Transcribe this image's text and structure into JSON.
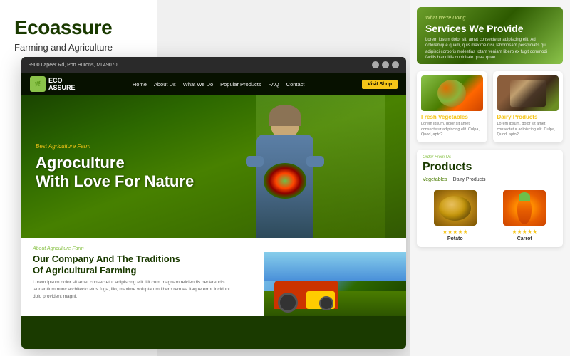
{
  "brand": {
    "title": "Ecoassure",
    "subtitle": "Farming and Agriculture"
  },
  "topbar": {
    "address": "9900 Lapeer Rd, Port Hurons, MI 49070"
  },
  "navbar": {
    "logo_text": "ECO\nASSURE",
    "links": [
      "Home",
      "About Us",
      "What We Do",
      "Popular Products",
      "FAQ",
      "Contact"
    ],
    "cta": "Visit Shop"
  },
  "hero": {
    "small_text": "Best Agriculture Farm",
    "title_line1": "Agroculture",
    "title_line2": "With Love For Nature"
  },
  "services": {
    "label": "What We're Doing",
    "title": "Services We Provide",
    "description": "Lorem ipsum dolor sit, amet consectetur adipiscing elit. Ad doloremque quam, quis maxime nisi, laboriosam perspiciatis qui adipisci corporis molestias totam veniam libero ex fugit commodi facilis blanditiis cupiditate quasi quae."
  },
  "cards": [
    {
      "title": "Fresh Vegetables",
      "text": "Lorem ipsum, dolor sit amet consectetur adipiscing elit. Culpa, Quod, apto?"
    },
    {
      "title": "Dairy Products",
      "text": "Lorem ipsum, dolor sit amet consectetur adipiscing elit. Culpa, Quod, apto?"
    }
  ],
  "products_section": {
    "intro": "Order From Us",
    "title": "Products",
    "tabs": [
      "Vegetables",
      "Dairy Products"
    ],
    "active_tab": "Vegetables",
    "items": [
      {
        "name": "Potato",
        "stars": "★★★★★"
      },
      {
        "name": "Carrot",
        "stars": "★★★★★"
      }
    ]
  },
  "about": {
    "label": "About Agriculture Farm",
    "title_line1": "Our Company And The Traditions",
    "title_line2": "Of Agricultural Farming",
    "text": "Lorem ipsum dolor sit amet consectetur adipiscing elit. Ut cum magnam reiciendis perferendis laudantium nunc architecto etus fuga, illo, maxime voluptatum libero rem ea itaque error incidunt dolo provident magni."
  }
}
